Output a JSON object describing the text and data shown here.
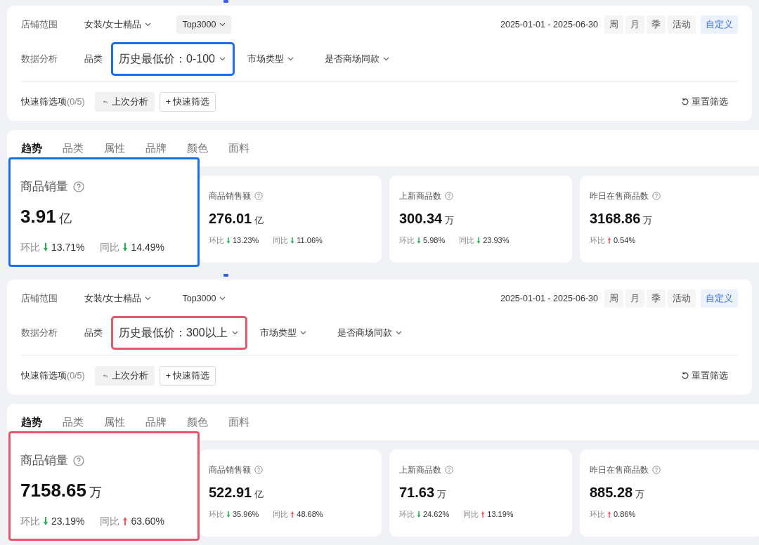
{
  "panels": [
    {
      "color": "#1a6ff0",
      "store_scope": {
        "label": "店铺范围",
        "dropdowns": [
          {
            "text": "女装/女士精品",
            "filled": false
          },
          {
            "text": "Top3000",
            "filled": true
          }
        ]
      },
      "date_range": {
        "start": "2025-01-01",
        "separator": "-",
        "end": "2025-06-30"
      },
      "period_buttons": [
        {
          "label": "周",
          "selected": false
        },
        {
          "label": "月",
          "selected": false
        },
        {
          "label": "季",
          "selected": false
        },
        {
          "label": "活动",
          "selected": false
        },
        {
          "label": "自定义",
          "selected": true
        }
      ],
      "analysis": {
        "label": "数据分析",
        "filters": [
          {
            "text": "品类",
            "kind": "plain"
          },
          {
            "text": "历史最低价：0-100",
            "kind": "highlighted"
          },
          {
            "text": "市场类型",
            "kind": "dropdown"
          },
          {
            "text": "是否商场同款",
            "kind": "dropdown"
          }
        ]
      },
      "quick": {
        "label": "快速筛选项",
        "count": "(0/5)",
        "buttons": [
          {
            "text": "上次分析",
            "kind": "undo"
          },
          {
            "text": "+ 快速筛选",
            "kind": "outline"
          }
        ],
        "reset": "重置筛选"
      },
      "tabs": [
        {
          "label": "趋势",
          "selected": true
        },
        {
          "label": "品类",
          "selected": false
        },
        {
          "label": "属性",
          "selected": false
        },
        {
          "label": "品牌",
          "selected": false
        },
        {
          "label": "颜色",
          "selected": false
        },
        {
          "label": "面料",
          "selected": false
        }
      ],
      "metrics": [
        {
          "title": "商品销量",
          "value": "3.91",
          "unit": "亿",
          "highlighted": true,
          "changes": [
            {
              "label": "环比",
              "kind": "down",
              "text": "13.71%"
            },
            {
              "label": "同比",
              "kind": "down",
              "text": "14.49%"
            }
          ]
        },
        {
          "title": "商品销售额",
          "value": "276.01",
          "unit": "亿",
          "highlighted": false,
          "changes": [
            {
              "label": "环比",
              "kind": "down",
              "text": "13.23%"
            },
            {
              "label": "同比",
              "kind": "down",
              "text": "11.06%"
            }
          ]
        },
        {
          "title": "上新商品数",
          "value": "300.34",
          "unit": "万",
          "highlighted": false,
          "changes": [
            {
              "label": "环比",
              "kind": "down",
              "text": "5.98%"
            },
            {
              "label": "同比",
              "kind": "down",
              "text": "23.93%"
            }
          ]
        },
        {
          "title": "昨日在售商品数",
          "value": "3168.86",
          "unit": "万",
          "highlighted": false,
          "changes": [
            {
              "label": "环比",
              "kind": "up",
              "text": "0.54%"
            }
          ]
        }
      ]
    },
    {
      "color": "#e8566c",
      "store_scope": {
        "label": "店铺范围",
        "dropdowns": [
          {
            "text": "女装/女士精品",
            "filled": false
          },
          {
            "text": "Top3000",
            "filled": false
          }
        ]
      },
      "date_range": {
        "start": "2025-01-01",
        "separator": "-",
        "end": "2025-06-30"
      },
      "period_buttons": [
        {
          "label": "周",
          "selected": false
        },
        {
          "label": "月",
          "selected": false
        },
        {
          "label": "季",
          "selected": false
        },
        {
          "label": "活动",
          "selected": false
        },
        {
          "label": "自定义",
          "selected": true
        }
      ],
      "analysis": {
        "label": "数据分析",
        "filters": [
          {
            "text": "品类",
            "kind": "plain"
          },
          {
            "text": "历史最低价：300以上",
            "kind": "highlighted"
          },
          {
            "text": "市场类型",
            "kind": "dropdown"
          },
          {
            "text": "是否商场同款",
            "kind": "dropdown"
          }
        ]
      },
      "quick": {
        "label": "快速筛选项",
        "count": "(0/5)",
        "buttons": [
          {
            "text": "上次分析",
            "kind": "undo"
          },
          {
            "text": "+ 快速筛选",
            "kind": "outline"
          }
        ],
        "reset": "重置筛选"
      },
      "tabs": [
        {
          "label": "趋势",
          "selected": true
        },
        {
          "label": "品类",
          "selected": false
        },
        {
          "label": "属性",
          "selected": false
        },
        {
          "label": "品牌",
          "selected": false
        },
        {
          "label": "颜色",
          "selected": false
        },
        {
          "label": "面料",
          "selected": false
        }
      ],
      "metrics": [
        {
          "title": "商品销量",
          "value": "7158.65",
          "unit": "万",
          "highlighted": true,
          "changes": [
            {
              "label": "环比",
              "kind": "down",
              "text": "23.19%"
            },
            {
              "label": "同比",
              "kind": "up",
              "text": "63.60%"
            }
          ]
        },
        {
          "title": "商品销售额",
          "value": "522.91",
          "unit": "亿",
          "highlighted": false,
          "changes": [
            {
              "label": "环比",
              "kind": "down",
              "text": "35.96%"
            },
            {
              "label": "同比",
              "kind": "up",
              "text": "48.68%"
            }
          ]
        },
        {
          "title": "上新商品数",
          "value": "71.63",
          "unit": "万",
          "highlighted": false,
          "changes": [
            {
              "label": "环比",
              "kind": "down",
              "text": "24.62%"
            },
            {
              "label": "同比",
              "kind": "up",
              "text": "13.19%"
            }
          ]
        },
        {
          "title": "昨日在售商品数",
          "value": "885.28",
          "unit": "万",
          "highlighted": false,
          "changes": [
            {
              "label": "环比",
              "kind": "up",
              "text": "0.86%"
            }
          ]
        }
      ]
    }
  ]
}
